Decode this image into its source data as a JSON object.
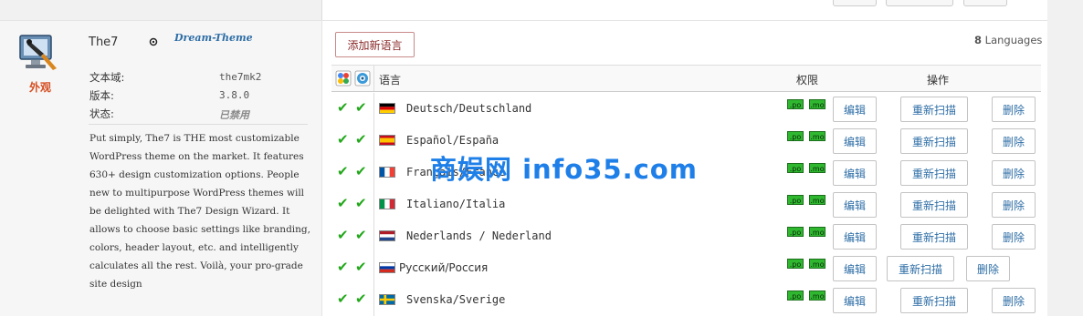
{
  "plugin": {
    "name": "The7",
    "author": "Dream-Theme",
    "category": "外观",
    "meta": [
      {
        "label": "文本域:",
        "value": "the7mk2"
      },
      {
        "label": "版本:",
        "value": "3.8.0"
      },
      {
        "label": "状态:",
        "value": "已禁用"
      }
    ],
    "description": "Put simply, The7 is THE most customizable WordPress theme on the market. It features 630+ design customization options. People new to multipurpose WordPress themes will be delighted with The7 Design Wizard. It allows to choose basic settings like branding, colors, header layout, etc. and intelligently calculates all the rest. Voilà, your pro-grade site design"
  },
  "toolbar": {
    "add_language_label": "添加新语言",
    "language_count": "8",
    "language_count_suffix": "Languages"
  },
  "table": {
    "headers": {
      "language": "语言",
      "permissions": "权限",
      "actions": "操作"
    },
    "rows": [
      {
        "language": "Deutsch/Deutschland",
        "flag": "de",
        "po": ".po",
        "mo": ".mo",
        "edit": "编辑",
        "rescan": "重新扫描",
        "delete": "删除"
      },
      {
        "language": "Español/España",
        "flag": "es",
        "po": ".po",
        "mo": ".mo",
        "edit": "编辑",
        "rescan": "重新扫描",
        "delete": "删除"
      },
      {
        "language": "Français/France",
        "flag": "fr",
        "po": ".po",
        "mo": ".mo",
        "edit": "编辑",
        "rescan": "重新扫描",
        "delete": "删除"
      },
      {
        "language": "Italiano/Italia",
        "flag": "it",
        "po": ".po",
        "mo": ".mo",
        "edit": "编辑",
        "rescan": "重新扫描",
        "delete": "删除"
      },
      {
        "language": "Nederlands / Nederland",
        "flag": "nl",
        "po": ".po",
        "mo": ".mo",
        "edit": "编辑",
        "rescan": "重新扫描",
        "delete": "删除"
      },
      {
        "language": "Русский/Россия",
        "flag": "ru",
        "po": ".po",
        "mo": ".mo",
        "edit": "编辑",
        "rescan": "重新扫描",
        "delete": "删除"
      },
      {
        "language": "Svenska/Sverige",
        "flag": "se",
        "po": ".po",
        "mo": ".mo",
        "edit": "编辑",
        "rescan": "重新扫描",
        "delete": "删除"
      }
    ]
  },
  "watermark": "商娱网 info35.com",
  "colors": {
    "accent_link": "#2e6ea6",
    "check_green": "#22a81a",
    "category_orange": "#d54e21",
    "permission_green": "#2fb82f",
    "watermark_blue": "#1e7fe8"
  }
}
